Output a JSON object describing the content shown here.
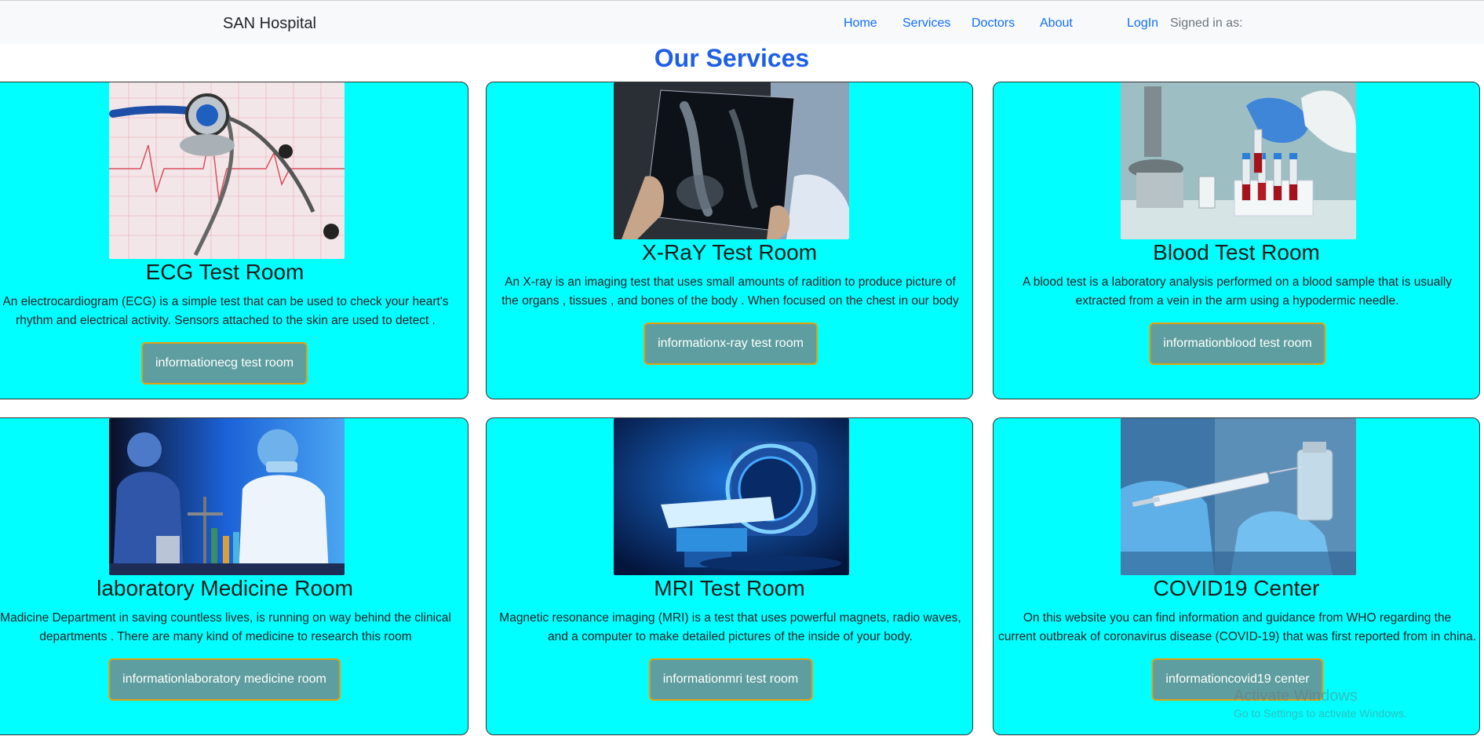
{
  "navbar": {
    "brand": "SAN Hospital",
    "links": [
      "Home",
      "Services",
      "Doctors",
      "About"
    ],
    "login": "LogIn",
    "signed_in": "Signed in as:"
  },
  "page": {
    "title": "Our Services"
  },
  "cards": [
    {
      "title": "ECG Test Room",
      "text_line1": "An electrocardiogram (ECG) is a simple test that can be used to check your heart's",
      "text_line2": "rhythm and electrical activity. Sensors attached to the skin are used to detect .",
      "button": "informationecg test room",
      "image_icon": "stethoscope-ecg-image"
    },
    {
      "title": "X-RaY Test Room",
      "text_line1": "An X-ray is an imaging test that uses small amounts of radition to produce picture of",
      "text_line2": "the organs , tissues , and bones of the body . When focused on the chest in our body",
      "button": "informationx-ray test room",
      "image_icon": "xray-image"
    },
    {
      "title": "Blood Test Room",
      "text_line1": "A blood test is a laboratory analysis performed on a blood sample that is usually",
      "text_line2": "extracted from a vein in the arm using a hypodermic needle.",
      "button": "informationblood test room",
      "image_icon": "blood-test-image"
    },
    {
      "title": "laboratory Medicine Room",
      "text_line1": "Madicine Department in saving countless lives, is running on way behind the clinical",
      "text_line2": "departments . There are many kind of medicine to research this room",
      "button": "informationlaboratory medicine room",
      "image_icon": "laboratory-image"
    },
    {
      "title": "MRI Test Room",
      "text_line1": "Magnetic resonance imaging (MRI) is a test that uses powerful magnets, radio waves,",
      "text_line2": "and a computer to make detailed pictures of the inside of your body.",
      "button": "informationmri test room",
      "image_icon": "mri-scanner-image"
    },
    {
      "title": "COVID19 Center",
      "text_line1": "On this website you can find information and guidance from WHO regarding the",
      "text_line2": "current outbreak of coronavirus disease (COVID-19) that was first reported from in china.",
      "button": "informationcovid19 center",
      "image_icon": "vaccine-syringe-image"
    }
  ],
  "watermark": {
    "title": "Activate Windows",
    "subtitle": "Go to Settings to activate Windows."
  },
  "colors": {
    "card_bg": "#00ffff",
    "button_bg": "#5f9ea0",
    "button_border": "#e3a00c",
    "title": "#1e5fe6",
    "nav_link": "#0d6efd"
  }
}
